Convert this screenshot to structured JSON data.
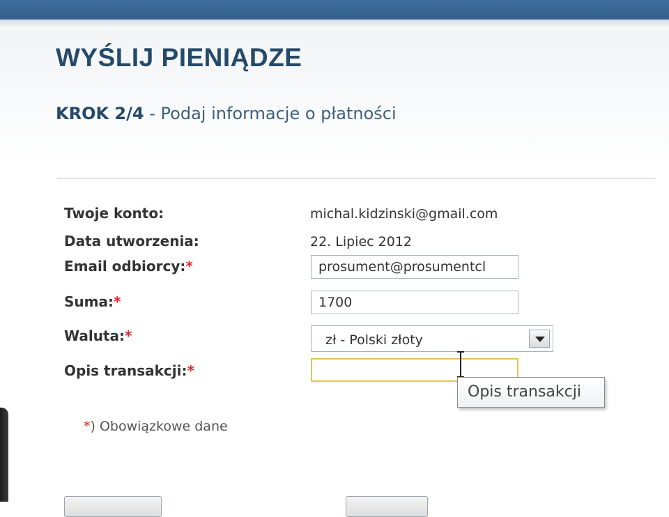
{
  "page": {
    "title": "WYŚLIJ PIENIĄDZE",
    "step_number": "KROK 2/4",
    "step_description": " - Podaj informacje o płatności"
  },
  "form": {
    "account_label": "Twoje konto:",
    "account_value": "michal.kidzinski@gmail.com",
    "created_label": "Data utworzenia:",
    "created_value": "22. Lipiec 2012",
    "recipient_label": "Email odbiorcy:",
    "recipient_value": "prosument@prosumentcl",
    "amount_label": "Suma:",
    "amount_value": "1700",
    "currency_label": "Waluta:",
    "currency_selected": "zł - Polski złoty",
    "description_label": "Opis transakcji:",
    "description_value": "",
    "required_marker": "*"
  },
  "tooltip": {
    "text": "Opis transakcji"
  },
  "note": {
    "marker": "*",
    "text": ") Obowiązkowe dane"
  },
  "colors": {
    "header_bar": "#3f6f9e",
    "title": "#244a6a",
    "required": "#d62b2b",
    "focus_border": "#e2c35a"
  }
}
